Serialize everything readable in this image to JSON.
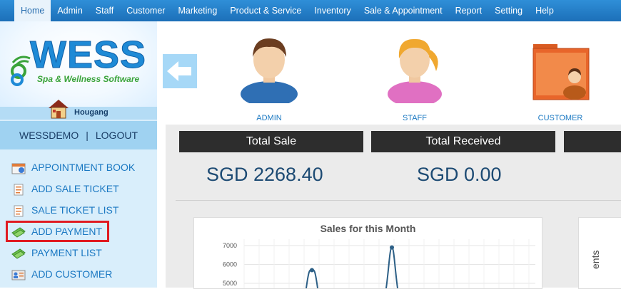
{
  "nav": {
    "items": [
      "Home",
      "Admin",
      "Staff",
      "Customer",
      "Marketing",
      "Product & Service",
      "Inventory",
      "Sale & Appointment",
      "Report",
      "Setting",
      "Help"
    ]
  },
  "sidebar": {
    "logo_text": "WESS",
    "logo_tagline": "Spa & Wellness Software",
    "branch": "Hougang",
    "user": "WESSDEMO",
    "separator": "|",
    "logout": "LOGOUT",
    "menu": [
      {
        "label": "APPOINTMENT BOOK",
        "icon": "calendar-icon"
      },
      {
        "label": "ADD SALE TICKET",
        "icon": "ticket-icon"
      },
      {
        "label": "SALE TICKET LIST",
        "icon": "ticket-list-icon"
      },
      {
        "label": "ADD PAYMENT",
        "icon": "money-icon"
      },
      {
        "label": "PAYMENT LIST",
        "icon": "money-list-icon"
      },
      {
        "label": "ADD CUSTOMER",
        "icon": "customer-card-icon"
      }
    ]
  },
  "quick_links": [
    {
      "label": "ADMIN",
      "icon": "admin-avatar-icon"
    },
    {
      "label": "STAFF",
      "icon": "staff-avatar-icon"
    },
    {
      "label": "CUSTOMER",
      "icon": "customer-folder-icon"
    }
  ],
  "dashboard": {
    "total_sale_label": "Total Sale",
    "total_sale_value": "SGD 2268.40",
    "total_received_label": "Total Received",
    "total_received_value": "SGD 0.00",
    "side_partial_text": "ents"
  },
  "chart_data": {
    "type": "line",
    "title": "Sales for this Month",
    "yticks": [
      5000,
      6000,
      7000
    ],
    "ylim": [
      4800,
      7200
    ],
    "points": [
      {
        "x": 1,
        "y": 5700
      },
      {
        "x": 2,
        "y": 6900
      }
    ],
    "series_color": "#2c5f86"
  }
}
